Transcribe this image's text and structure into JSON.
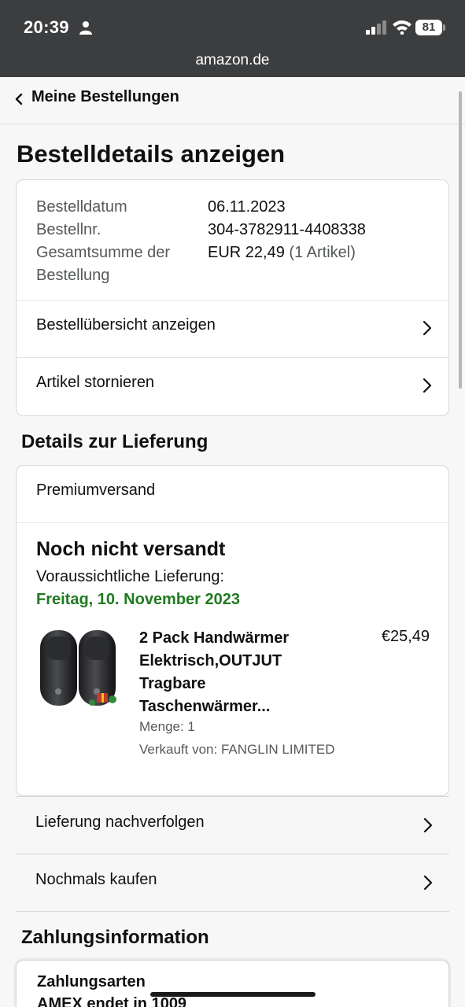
{
  "status_bar": {
    "time": "20:39",
    "battery": "81"
  },
  "browser": {
    "url": "amazon.de"
  },
  "nav": {
    "back_label": "Meine Bestellungen"
  },
  "page_title": "Bestelldetails anzeigen",
  "order_summary": {
    "date_label": "Bestelldatum",
    "date_value": "06.11.2023",
    "number_label": "Bestellnr.",
    "number_value": "304-3782911-4408338",
    "total_label_line1": "Gesamtsumme der",
    "total_label_line2": "Bestellung",
    "total_value": "EUR 22,49",
    "total_items": "(1 Artikel)",
    "links": [
      {
        "label": "Bestellübersicht anzeigen"
      },
      {
        "label": "Artikel stornieren"
      }
    ]
  },
  "delivery": {
    "section_title": "Details zur Lieferung",
    "shipping_method": "Premiumversand",
    "status": "Noch nicht versandt",
    "eta_label": "Voraussichtliche Lieferung:",
    "eta_date": "Freitag, 10. November 2023",
    "product": {
      "title": "2 Pack Handwärmer Elektrisch,OUTJUT Tragbare Taschenwärmer...",
      "price": "€25,49",
      "quantity": "Menge: 1",
      "seller": "Verkauft von: FANGLIN LIMITED"
    },
    "actions": [
      {
        "label": "Lieferung nachverfolgen"
      },
      {
        "label": "Nochmals kaufen"
      }
    ]
  },
  "payment": {
    "section_title": "Zahlungsinformation",
    "methods_label": "Zahlungsarten",
    "method_value": "AMEX endet in 1009"
  },
  "colors": {
    "status_bar_bg": "#3c3d3f",
    "eta_green": "#1f7a1f",
    "background": "#f7f7f7"
  }
}
